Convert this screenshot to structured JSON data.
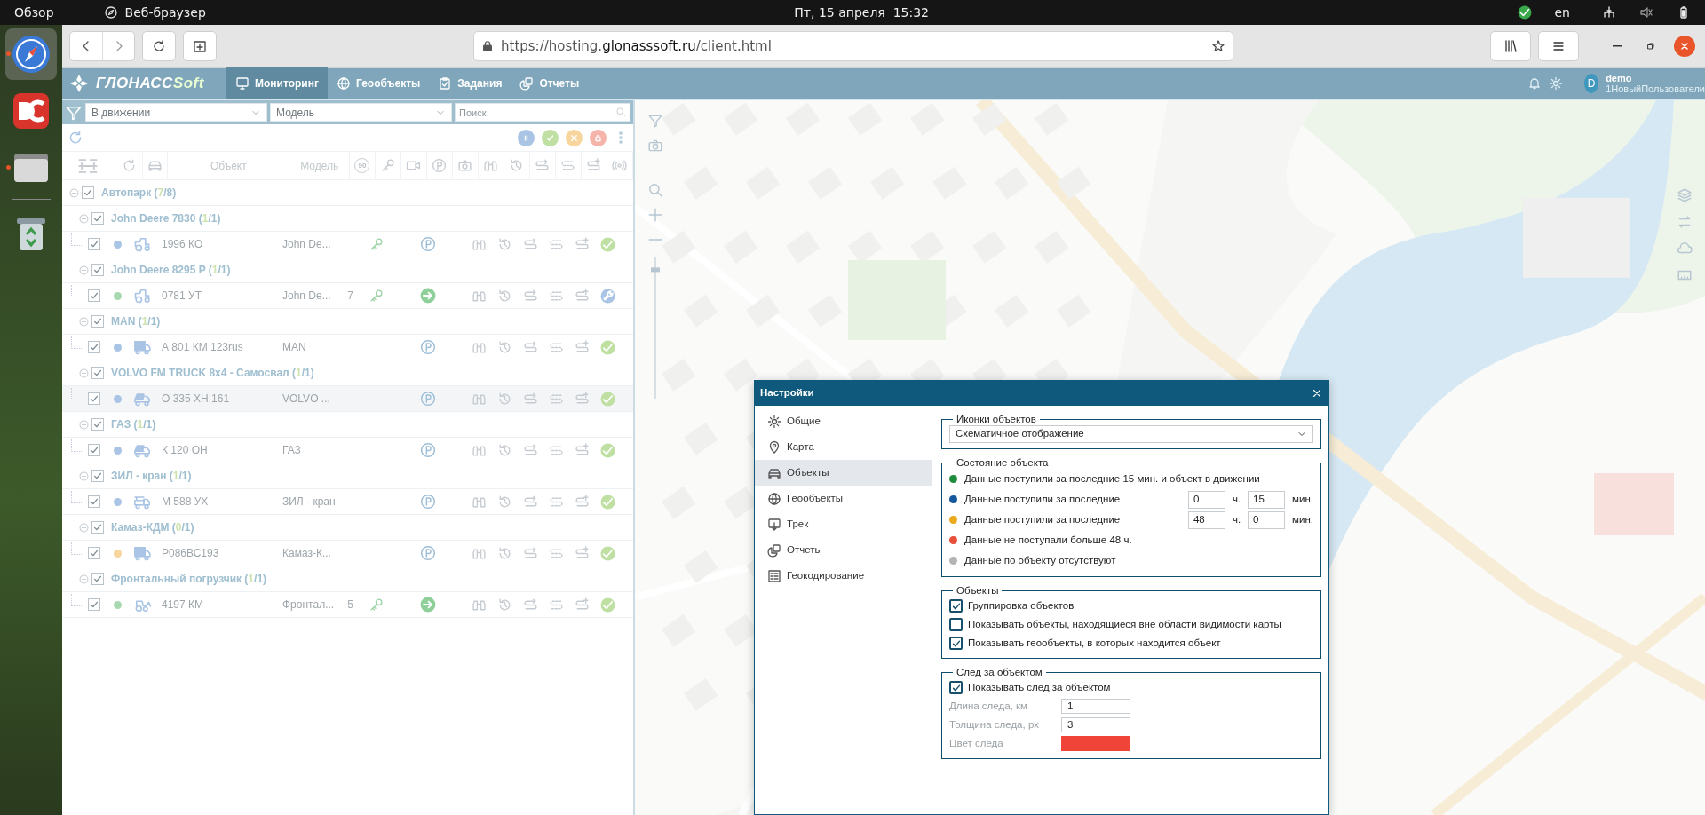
{
  "system_bar": {
    "activities": "Обзор",
    "app_menu": "Веб-браузер",
    "clock": "Пт, 15 апреля  15:32",
    "keyboard_layout": "en"
  },
  "dock": [
    {
      "kind": "browser",
      "selected": true,
      "running": true
    },
    {
      "kind": "editor",
      "selected": false,
      "running": false
    },
    {
      "kind": "files",
      "selected": false,
      "running": true
    },
    {
      "kind": "trash",
      "selected": false,
      "running": false
    }
  ],
  "browser": {
    "url": "https://hosting.**glonasssoft.ru**/client.html"
  },
  "app": {
    "logo": {
      "main": "ГЛОНАСС",
      "accent": "Soft"
    },
    "nav": [
      {
        "label": "Мониторинг",
        "kind": "monitor",
        "selected": true
      },
      {
        "label": "Геообъекты",
        "kind": "globe",
        "selected": false
      },
      {
        "label": "Задания",
        "kind": "tasks",
        "selected": false
      },
      {
        "label": "Отчеты",
        "kind": "reports",
        "selected": false
      }
    ],
    "user": {
      "initial": "D",
      "name": "demo",
      "group": "1НовыйПользователи"
    }
  },
  "panel": {
    "filters": [
      {
        "value": "В движении"
      },
      {
        "value": "Модель"
      }
    ],
    "search": {
      "placeholder": "Поиск"
    },
    "status_filters": [
      {
        "kind": "paused",
        "color": "#a9c4e4"
      },
      {
        "kind": "online",
        "color": "#bfe0a2"
      },
      {
        "kind": "warning",
        "color": "#f7d59c"
      },
      {
        "kind": "blocked",
        "color": "#f5b3aa"
      }
    ],
    "columns": [
      {
        "kind": "expand"
      },
      {
        "kind": "refresh"
      },
      {
        "kind": "car"
      },
      {
        "kind": "text",
        "label": "Объект"
      },
      {
        "kind": "text",
        "label": "Модель"
      },
      {
        "kind": "speed",
        "label": "90"
      },
      {
        "kind": "key"
      },
      {
        "kind": "video"
      },
      {
        "kind": "parking"
      },
      {
        "kind": "camera"
      },
      {
        "kind": "binoculars"
      },
      {
        "kind": "clock"
      },
      {
        "kind": "track_a"
      },
      {
        "kind": "track_b"
      },
      {
        "kind": "track_c"
      },
      {
        "kind": "signal"
      }
    ],
    "tree": [
      {
        "name": "Автопарк",
        "count": {
          "open": "(",
          "active": "7",
          "rest": "/8)"
        },
        "expanded": true,
        "checked": true,
        "children": [
          {
            "name": "John Deere 7830",
            "count": {
              "open": "(",
              "active": "1",
              "rest": "/1)"
            },
            "expanded": true,
            "checked": true,
            "children": [
              {
                "kind": "tractor",
                "checked": true,
                "selected": false,
                "color": "#a9c4e4",
                "plate": "1996 КО",
                "model": "John De...",
                "ignition": true,
                "moving": false,
                "service": false
              }
            ]
          },
          {
            "name": "John Deere 8295 P",
            "count": {
              "open": "(",
              "active": "1",
              "rest": "/1)"
            },
            "expanded": true,
            "checked": true,
            "children": [
              {
                "kind": "tractor",
                "checked": true,
                "selected": false,
                "color": "#a8d8b0",
                "plate": "0781 УТ",
                "model": "John De...",
                "speed": "7",
                "ignition": true,
                "moving": true,
                "service": true
              }
            ]
          },
          {
            "name": "MAN",
            "count": {
              "open": "(",
              "active": "1",
              "rest": "/1)"
            },
            "expanded": true,
            "checked": true,
            "children": [
              {
                "kind": "truck",
                "checked": true,
                "selected": false,
                "color": "#a9c4e4",
                "plate": "А 801 КМ 123rus",
                "model": "MAN",
                "ignition": false,
                "moving": false,
                "service": false
              }
            ]
          },
          {
            "name": "VOLVO FM TRUCK 8x4 - Самосвал",
            "count": {
              "open": "(",
              "active": "1",
              "rest": "/1)"
            },
            "expanded": true,
            "checked": true,
            "children": [
              {
                "kind": "dumper",
                "checked": true,
                "selected": true,
                "color": "#a9c4e4",
                "plate": "О 335 ХН 161",
                "model": "VOLVO ...",
                "ignition": false,
                "moving": false,
                "service": false
              }
            ]
          },
          {
            "name": "ГАЗ",
            "count": {
              "open": "(",
              "active": "1",
              "rest": "/1)"
            },
            "expanded": true,
            "checked": true,
            "children": [
              {
                "kind": "dumper",
                "checked": true,
                "selected": false,
                "color": "#a9c4e4",
                "plate": "К 120 ОН",
                "model": "ГАЗ",
                "ignition": false,
                "moving": false,
                "service": false
              }
            ]
          },
          {
            "name": "ЗИЛ - кран",
            "count": {
              "open": "(",
              "active": "1",
              "rest": "/1)"
            },
            "expanded": true,
            "checked": true,
            "children": [
              {
                "kind": "crane",
                "checked": true,
                "selected": false,
                "color": "#a9c4e4",
                "plate": "М 588 УХ",
                "model": "ЗИЛ - кран",
                "ignition": false,
                "moving": false,
                "service": false
              }
            ]
          },
          {
            "name": "Камаз-КДМ",
            "count": {
              "open": "(",
              "active": "0",
              "rest": "/1)"
            },
            "expanded": true,
            "checked": true,
            "children": [
              {
                "kind": "truck",
                "checked": true,
                "selected": false,
                "color": "#f7d59c",
                "plate": "Р086ВС193",
                "model": "Камаз-К...",
                "ignition": false,
                "moving": false,
                "service": false
              }
            ]
          },
          {
            "name": "Фронтальный погрузчик",
            "count": {
              "open": "(",
              "active": "1",
              "rest": "/1)"
            },
            "expanded": true,
            "checked": true,
            "children": [
              {
                "kind": "loader",
                "checked": true,
                "selected": false,
                "color": "#a8d8b0",
                "plate": "4197 КМ",
                "model": "Фронтал...",
                "speed": "5",
                "ignition": true,
                "moving": true,
                "service": false
              }
            ]
          }
        ]
      }
    ]
  },
  "map": {
    "zoom": {
      "level": 0.92
    }
  },
  "settings_dialog": {
    "title": "Настройки",
    "nav": [
      {
        "label": "Общие",
        "kind": "gear",
        "selected": false
      },
      {
        "label": "Карта",
        "kind": "pin",
        "selected": false
      },
      {
        "label": "Объекты",
        "kind": "car",
        "selected": true
      },
      {
        "label": "Геообъекты",
        "kind": "globe",
        "selected": false
      },
      {
        "label": "Трек",
        "kind": "track",
        "selected": false
      },
      {
        "label": "Отчеты",
        "kind": "reports",
        "selected": false
      },
      {
        "label": "Геокодирование",
        "kind": "list",
        "selected": false
      }
    ],
    "icons_section": {
      "legend": "Иконки объектов",
      "value": "Схематичное отображение"
    },
    "state_section": {
      "legend": "Состояние объекта",
      "rows": [
        {
          "kind": "plain",
          "color": "#1e8c3c",
          "text": "Данные поступили за последние 15 мин. и объект в движении"
        },
        {
          "kind": "range",
          "color": "#15589e",
          "text": "Данные поступили за последние",
          "hours": "0",
          "hours_unit": "ч.",
          "minutes": "15",
          "minutes_unit": "мин."
        },
        {
          "kind": "range",
          "color": "#eba91c",
          "text": "Данные поступили за последние",
          "hours": "48",
          "hours_unit": "ч.",
          "minutes": "0",
          "minutes_unit": "мин."
        },
        {
          "kind": "plain",
          "color": "#e8503a",
          "text": "Данные не поступали больше 48 ч."
        },
        {
          "kind": "plain",
          "color": "#b4b4b4",
          "text": "Данные по объекту отсутствуют"
        }
      ]
    },
    "objects_section": {
      "legend": "Объекты",
      "options": [
        {
          "label": "Группировка объектов",
          "checked": true
        },
        {
          "label": "Показывать объекты, находящиеся вне области видимости карты",
          "checked": false
        },
        {
          "label": "Показывать геообъекты, в которых находится объект",
          "checked": true
        }
      ]
    },
    "trail_section": {
      "legend": "След за объектом",
      "show": {
        "label": "Показывать след за объектом",
        "checked": true
      },
      "fields": [
        {
          "label": "Длина следа, км",
          "value": "1"
        },
        {
          "label": "Толщина следа, px",
          "value": "3"
        }
      ],
      "color_field": {
        "label": "Цвет следа",
        "color": "#f04438"
      }
    }
  }
}
